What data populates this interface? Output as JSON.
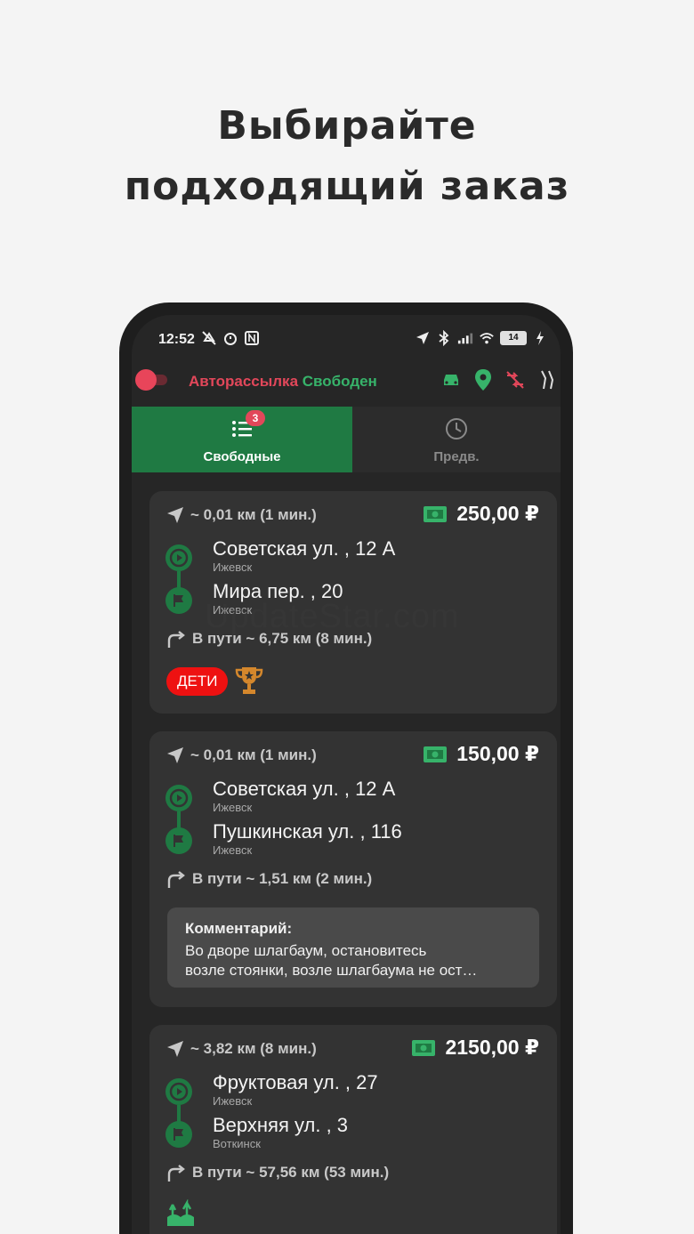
{
  "headline": {
    "line1": "Выбирайте",
    "line2": "подходящий заказ"
  },
  "status_bar": {
    "time": "12:52",
    "battery": "14"
  },
  "app_bar": {
    "auto_label": "Авторассылка",
    "state_label": "Свободен",
    "colors": {
      "auto": "#e2475a",
      "state": "#37b36a",
      "accent": "#1f7a43"
    }
  },
  "tabs": [
    {
      "label": "Свободные",
      "badge": "3",
      "active": true
    },
    {
      "label": "Предв.",
      "active": false
    }
  ],
  "orders": [
    {
      "distance": "~ 0,01 км (1 мин.)",
      "price": "250,00 ₽",
      "from_address": "Советская ул. , 12 А",
      "from_city": "Ижевск",
      "to_address": "Мира пер. , 20",
      "to_city": "Ижевск",
      "in_route": "В пути ~ 6,75 км (8 мин.)",
      "tag": "ДЕТИ"
    },
    {
      "distance": "~ 0,01 км (1 мин.)",
      "price": "150,00 ₽",
      "from_address": "Советская ул. , 12 А",
      "from_city": "Ижевск",
      "to_address": "Пушкинская ул. , 116",
      "to_city": "Ижевск",
      "in_route": "В пути ~ 1,51 км (2 мин.)",
      "comment_title": "Комментарий:",
      "comment_line1": "Во дворе шлагбаум, остановитесь",
      "comment_line2": "возле стоянки, возле шлагбаума не ост…"
    },
    {
      "distance": "~ 3,82 км (8 мин.)",
      "price": "2150,00 ₽",
      "from_address": "Фруктовая ул. , 27",
      "from_city": "Ижевск",
      "to_address": "Верхняя ул. , 3",
      "to_city": "Воткинск",
      "in_route": "В пути ~ 57,56 км (53 мин.)"
    }
  ],
  "watermark": "UpdateStar.com"
}
